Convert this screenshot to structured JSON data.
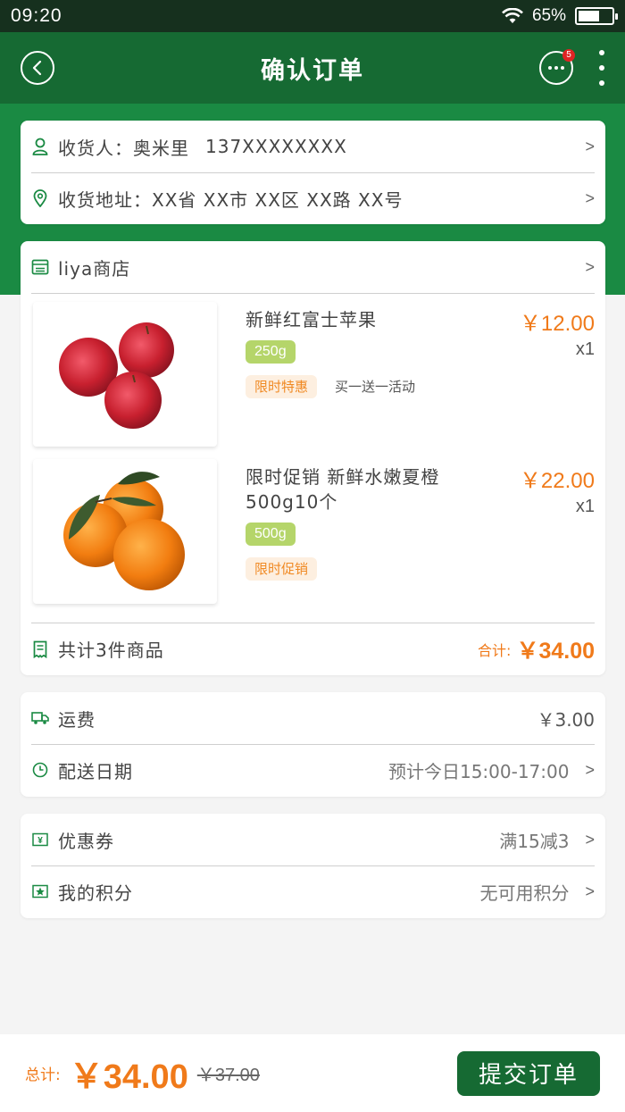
{
  "status": {
    "time": "09:20",
    "battery": "65%",
    "battery_level": 0.65
  },
  "header": {
    "title": "确认订单",
    "badge_count": "5"
  },
  "address": {
    "receiver_label": "收货人：",
    "receiver_name": "奥米里",
    "receiver_phone": "137XXXXXXXX",
    "address_label": "收货地址：",
    "address_value": "XX省 XX市 XX区 XX路 XX号",
    "chevron": ">"
  },
  "store": {
    "name": "liya商店",
    "chevron": ">",
    "products": [
      {
        "name": "新鲜红富士苹果",
        "price": "￥12.00",
        "qty": "x1",
        "weight": "250g",
        "promo": "限时特惠",
        "promo_note": "买一送一活动"
      },
      {
        "name": "限时促销 新鲜水嫩夏橙500g10个",
        "price": "￥22.00",
        "qty": "x1",
        "weight": "500g",
        "promo": "限时促销"
      }
    ],
    "summary_label": "共计3件商品",
    "total_label": "合计:",
    "total": "￥34.00"
  },
  "delivery": {
    "shipping_label": "运费",
    "shipping_value": "￥3.00",
    "date_label": "配送日期",
    "date_value": "预计今日15:00-17:00",
    "chevron": ">"
  },
  "discounts": {
    "coupon_label": "优惠券",
    "coupon_value": "满15减3",
    "points_label": "我的积分",
    "points_value": "无可用积分",
    "chevron": ">"
  },
  "footer": {
    "total_label": "总计:",
    "total": "￥34.00",
    "original": "￥37.00",
    "submit_label": "提交订单"
  },
  "colors": {
    "nav": "#166a33",
    "band": "#1a8a43",
    "accent": "#f07a1a",
    "status_bar": "#16301e"
  },
  "icons": [
    "back-icon",
    "more-icon",
    "kebab-icon",
    "person-icon",
    "location-icon",
    "store-icon",
    "receipt-icon",
    "truck-icon",
    "clock-icon",
    "coupon-icon",
    "points-icon"
  ]
}
